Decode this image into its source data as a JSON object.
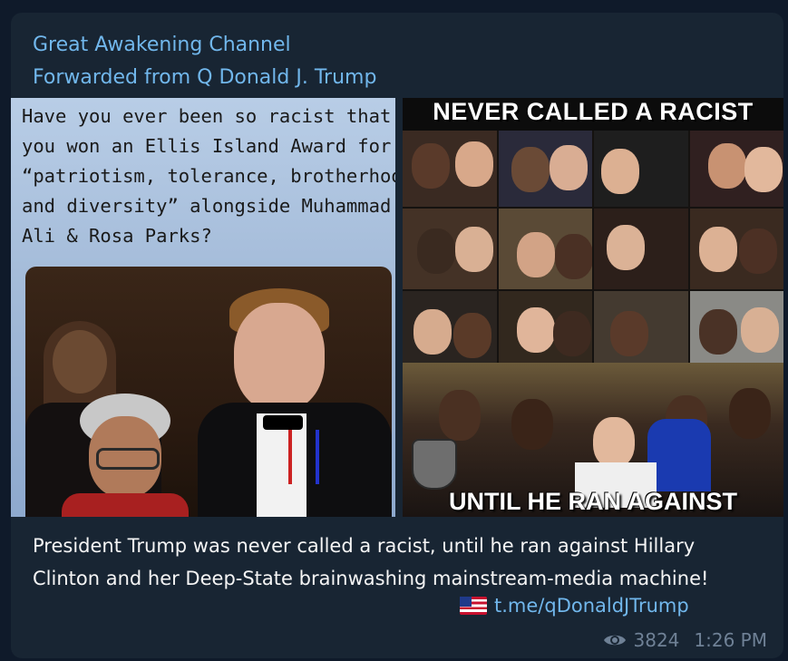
{
  "message": {
    "channel_name": "Great Awakening Channel",
    "forwarded_from": "Forwarded from Q Donald J. Trump",
    "left_image": {
      "lines": [
        "Have you ever been so racist that",
        "you won an Ellis Island Award for",
        "“patriotism, tolerance, brotherhood",
        "and diversity” alongside Muhammad",
        "Ali & Rosa Parks?"
      ]
    },
    "right_image": {
      "title": "NEVER CALLED A RACIST",
      "caption": "UNTIL HE RAN AGAINST"
    },
    "text": "President Trump was never called a racist, until he ran against Hillary Clinton and her Deep-State brainwashing mainstream-media machine!",
    "flag_icon": "us-flag-icon",
    "link": "t.me/qDonaldJTrump",
    "views": "3824",
    "time": "1:26 PM"
  },
  "colors": {
    "background": "#0f1a2a",
    "bubble": "#182533",
    "accent": "#71b7ec",
    "text": "#f5f5f5",
    "meta": "#6f8196"
  }
}
